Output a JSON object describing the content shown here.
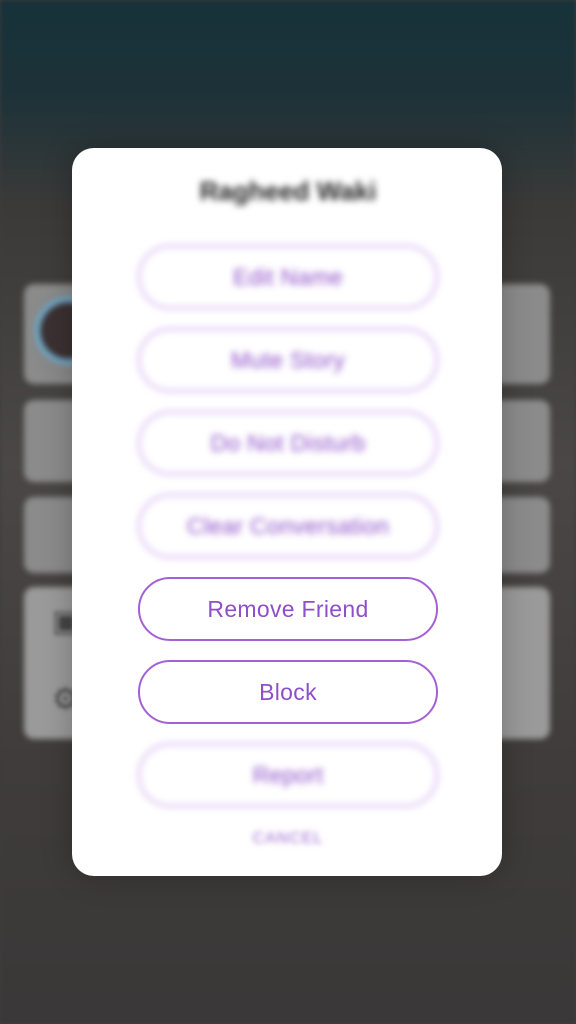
{
  "dialog": {
    "title": "Ragheed Waki",
    "options": [
      {
        "label": "Edit Name"
      },
      {
        "label": "Mute Story"
      },
      {
        "label": "Do Not Disturb"
      },
      {
        "label": "Clear Conversation"
      },
      {
        "label": "Remove Friend"
      },
      {
        "label": "Block"
      },
      {
        "label": "Report"
      }
    ],
    "cancel": "CANCEL"
  },
  "background_icons": [
    "story-settings-icon",
    "gear-icon"
  ],
  "colors": {
    "accent": "#8e4fc9",
    "sheet": "#ffffff",
    "overlay": "#3f3d3d"
  }
}
